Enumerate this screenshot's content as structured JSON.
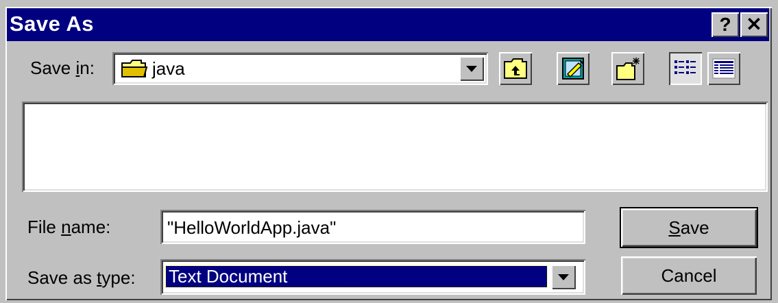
{
  "window": {
    "title": "Save As",
    "help_button": "?",
    "close_button": "✕"
  },
  "save_in": {
    "label_pre": "Save ",
    "label_ul": "i",
    "label_post": "n:",
    "value": "java",
    "icon": "folder-icon"
  },
  "toolbar": {
    "up_folder": "up-one-level-icon",
    "desktop": "desktop-icon",
    "new_folder": "new-folder-icon",
    "list_view": "list-view-icon",
    "details_view": "details-view-icon"
  },
  "file_name": {
    "label_pre": "File ",
    "label_ul": "n",
    "label_post": "ame:",
    "value": "\"HelloWorldApp.java\""
  },
  "save_type": {
    "label_pre": "Save as ",
    "label_ul": "t",
    "label_post": "ype:",
    "value": "Text Document"
  },
  "buttons": {
    "save_ul": "S",
    "save_post": "ave",
    "cancel": "Cancel"
  },
  "colors": {
    "title_bar": "#000080",
    "face": "#c0c0c0",
    "highlight": "#000080"
  }
}
